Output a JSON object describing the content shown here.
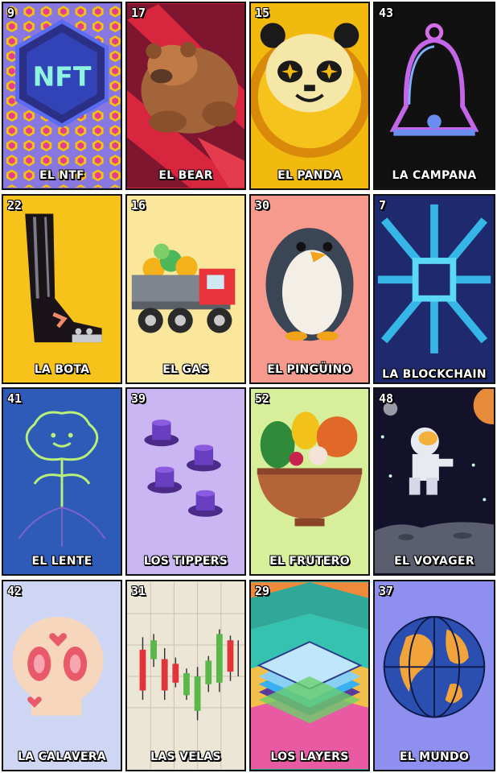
{
  "cards": [
    {
      "number": "9",
      "name": "EL NTF",
      "icon": "nft-hexagon-icon",
      "bg": "#7a6fd8"
    },
    {
      "number": "17",
      "name": "EL BEAR",
      "icon": "bear-icon",
      "bg": "#c8213a"
    },
    {
      "number": "15",
      "name": "EL PANDA",
      "icon": "panda-coin-icon",
      "bg": "#f2b90f"
    },
    {
      "number": "43",
      "name": "LA CAMPANA",
      "icon": "bell-icon",
      "bg": "#111111"
    },
    {
      "number": "22",
      "name": "LA BOTA",
      "icon": "boot-icon",
      "bg": "#f7c21a"
    },
    {
      "number": "16",
      "name": "EL GAS",
      "icon": "truck-icon",
      "bg": "#fbe79c"
    },
    {
      "number": "30",
      "name": "EL PINGÜINO",
      "icon": "penguin-icon",
      "bg": "#f59a8c"
    },
    {
      "number": "7",
      "name": "LA BLOCKCHAIN",
      "icon": "chain-icon",
      "bg": "#1f2a6e"
    },
    {
      "number": "41",
      "name": "EL LENTE",
      "icon": "flower-icon",
      "bg": "#2f5bb8"
    },
    {
      "number": "39",
      "name": "LOS TIPPERS",
      "icon": "tophat-icon",
      "bg": "#c9b6f2"
    },
    {
      "number": "52",
      "name": "EL FRUTERO",
      "icon": "fruit-bowl-icon",
      "bg": "#d7ee9a"
    },
    {
      "number": "48",
      "name": "EL VOYAGER",
      "icon": "astronaut-icon",
      "bg": "#14122a"
    },
    {
      "number": "42",
      "name": "LA CALAVERA",
      "icon": "skull-icon",
      "bg": "#cfd6f4"
    },
    {
      "number": "31",
      "name": "LAS VELAS",
      "icon": "candlestick-icon",
      "bg": "#ece6d6"
    },
    {
      "number": "29",
      "name": "LOS LAYERS",
      "icon": "layers-icon",
      "bg": "#2fa89a"
    },
    {
      "number": "37",
      "name": "EL MUNDO",
      "icon": "globe-icon",
      "bg": "#8f8ff0"
    }
  ]
}
